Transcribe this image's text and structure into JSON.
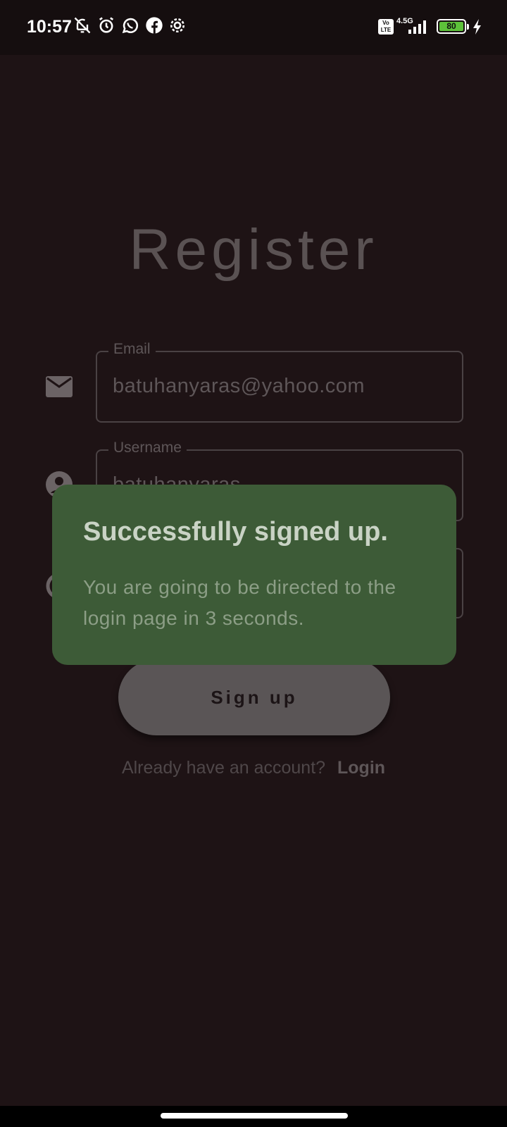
{
  "status_bar": {
    "time": "10:57",
    "network": "4.5G",
    "volte": "Vo LTE",
    "battery_level": "80",
    "battery_color": "#5dc23a",
    "icons": [
      "bell-off-icon",
      "alarm-icon",
      "whatsapp-icon",
      "facebook-icon",
      "settings-icon",
      "signal-icon",
      "charging-icon"
    ]
  },
  "page": {
    "title": "Register"
  },
  "form": {
    "email": {
      "label": "Email",
      "value": "batuhanyaras@yahoo.com",
      "icon": "mail-icon"
    },
    "username": {
      "label": "Username",
      "value": "batuhanyaras",
      "icon": "person-icon"
    },
    "password": {
      "icon": "lock-icon"
    }
  },
  "signup_button": {
    "label": "Sign up"
  },
  "login_prompt": {
    "text": "Already have an account?",
    "link": "Login"
  },
  "snackbar": {
    "title": "Successfully signed up.",
    "message": "You are going to be directed to the login page in 3 seconds.",
    "background": "#3d5b37"
  }
}
